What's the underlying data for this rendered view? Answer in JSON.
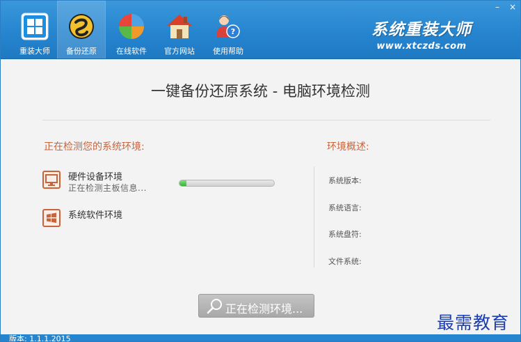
{
  "nav": {
    "items": [
      {
        "label": "重装大师",
        "icon": "windows-logo-icon"
      },
      {
        "label": "备份还原",
        "icon": "backup-disc-icon"
      },
      {
        "label": "在线软件",
        "icon": "pie-chart-icon"
      },
      {
        "label": "官方网站",
        "icon": "home-icon"
      },
      {
        "label": "使用帮助",
        "icon": "help-users-icon"
      }
    ],
    "active_index": 1
  },
  "window_controls": {
    "minimize": "–",
    "close": "×"
  },
  "brand": {
    "title": "系统重装大师",
    "url": "www.xtczds.com"
  },
  "main": {
    "title": "一键备份还原系统 - 电脑环境检测"
  },
  "detection": {
    "heading": "正在检测您的系统环境:",
    "items": [
      {
        "title": "硬件设备环境",
        "subtitle": "正在检测主板信息...",
        "icon": "monitor-icon"
      },
      {
        "title": "系统软件环境",
        "subtitle": "",
        "icon": "windows-flag-icon"
      }
    ],
    "progress_fraction": 0.07
  },
  "summary": {
    "heading": "环境概述:",
    "labels": [
      "系统版本:",
      "系统语言:",
      "系统盘符:",
      "文件系统:"
    ]
  },
  "action": {
    "label": "正在检测环境..."
  },
  "watermark": "最需教育",
  "status": {
    "version": "版本: 1.1.1.2015"
  },
  "colors": {
    "header_blue": "#2685cf",
    "accent_orange": "#c8643c",
    "progress_green": "#36b335",
    "watermark_blue": "#1b3db0"
  }
}
